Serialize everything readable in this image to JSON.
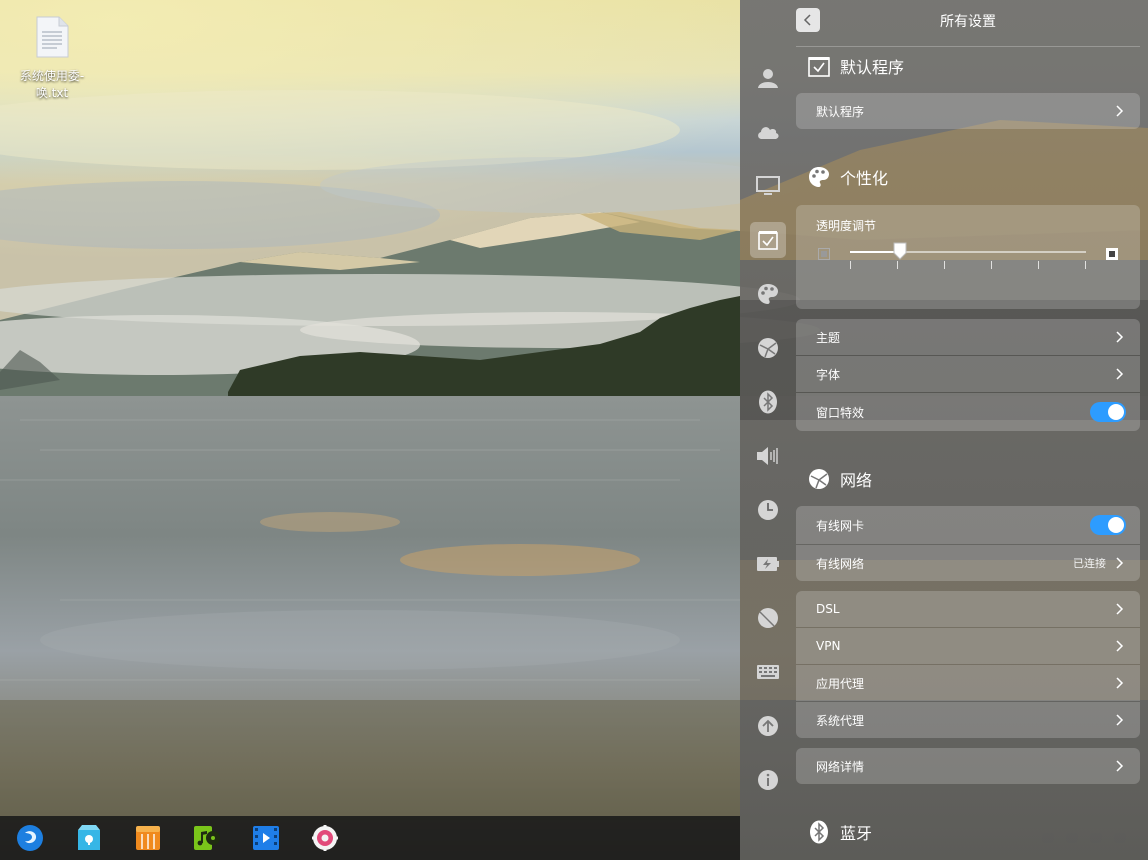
{
  "desktop": {
    "file_icon": "text-file-icon",
    "file_label": "系统使用委-唤.txt"
  },
  "dock": {
    "items": [
      {
        "name": "launcher-icon",
        "color": "#2a8cf0"
      },
      {
        "name": "app-store-icon",
        "color": "#34b7e8"
      },
      {
        "name": "archive-icon",
        "color": "#f08a1e"
      },
      {
        "name": "music-icon",
        "color": "#7ac51a"
      },
      {
        "name": "video-icon",
        "color": "#1f7ee8"
      },
      {
        "name": "settings-icon",
        "color": "#e24a7a"
      }
    ]
  },
  "settings": {
    "title": "所有设置",
    "back_icon": "chevron-left-icon",
    "nav": [
      "account-icon",
      "cloud-icon",
      "display-icon",
      "default-apps-icon",
      "personalization-icon",
      "network-icon",
      "bluetooth-icon",
      "sound-icon",
      "time-icon",
      "power-icon",
      "mouse-icon",
      "keyboard-icon",
      "update-icon",
      "info-icon"
    ],
    "nav_active_index": 3,
    "sections": {
      "default_apps": {
        "title": "默认程序",
        "row": "默认程序"
      },
      "personalization": {
        "title": "个性化",
        "transparency_label": "透明度调节",
        "transparency_percent": 21,
        "rows": {
          "theme": "主题",
          "font": "字体",
          "window_effects": "窗口特效"
        },
        "window_effects_on": true
      },
      "network": {
        "title": "网络",
        "rows": {
          "wired_card": "有线网卡",
          "wired_network": "有线网络",
          "wired_status": "已连接",
          "dsl": "DSL",
          "vpn": "VPN",
          "app_proxy": "应用代理",
          "system_proxy": "系统代理",
          "details": "网络详情"
        },
        "wired_card_on": true
      },
      "bluetooth": {
        "title": "蓝牙"
      }
    },
    "accent_color": "#2d9cff"
  }
}
